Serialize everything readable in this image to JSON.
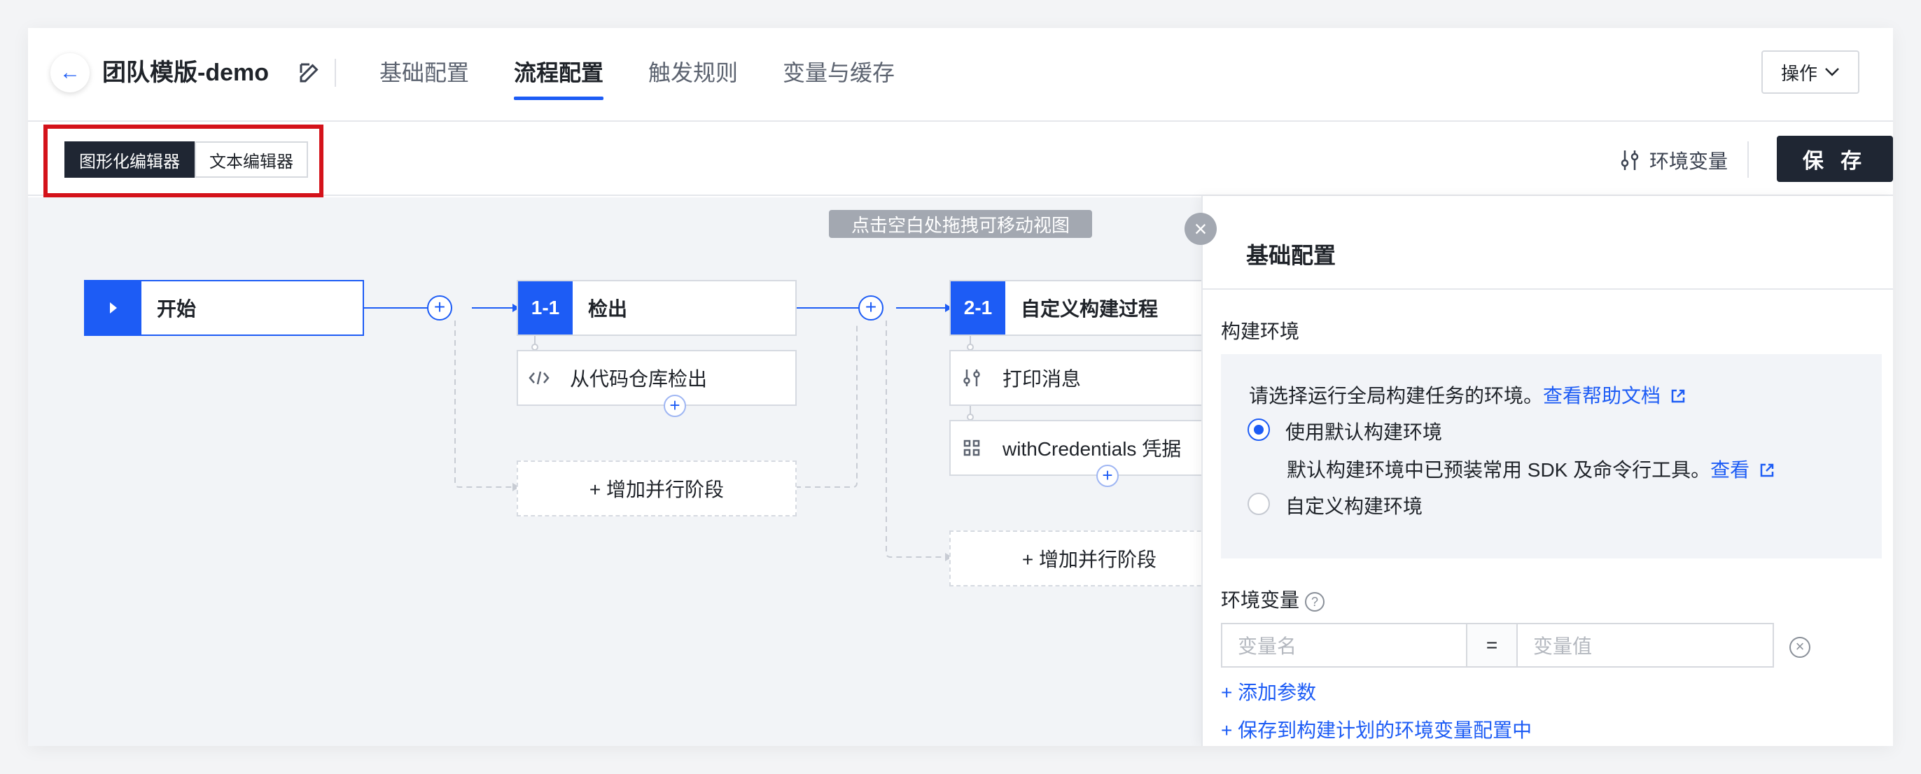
{
  "header": {
    "title": "团队模版-demo",
    "tabs": [
      {
        "label": "基础配置"
      },
      {
        "label": "流程配置"
      },
      {
        "label": "触发规则"
      },
      {
        "label": "变量与缓存"
      }
    ],
    "active_tab": "流程配置",
    "ops_label": "操作"
  },
  "toolbar": {
    "editor_modes": [
      "图形化编辑器",
      "文本编辑器"
    ],
    "active_mode": "图形化编辑器",
    "env_var_label": "环境变量",
    "save_label": "保 存"
  },
  "canvas": {
    "hint": "点击空白处拖拽可移动视图",
    "start_label": "开始",
    "stages": [
      {
        "badge": "1-1",
        "title": "检出",
        "steps": [
          "从代码仓库检出"
        ],
        "add_parallel": "+ 增加并行阶段"
      },
      {
        "badge": "2-1",
        "title": "自定义构建过程",
        "steps": [
          "打印消息",
          "withCredentials 凭据"
        ],
        "add_parallel": "+ 增加并行阶段"
      }
    ]
  },
  "panel": {
    "title": "基础配置",
    "build_env_label": "构建环境",
    "env_prompt": "请选择运行全局构建任务的环境。",
    "help_link": "查看帮助文档",
    "option_default": "使用默认构建环境",
    "option_default_desc": "默认构建环境中已预装常用 SDK 及命令行工具。",
    "view_link": "查看",
    "option_custom": "自定义构建环境",
    "selected_option": "使用默认构建环境",
    "env_vars_label": "环境变量",
    "var_name_placeholder": "变量名",
    "equals": "=",
    "var_value_placeholder": "变量值",
    "add_param": "+ 添加参数",
    "save_to_plan": "+ 保存到构建计划的环境变量配置中"
  },
  "colors": {
    "accent": "#1d5cf5",
    "dark": "#1f2633",
    "highlight_box": "#d4121a"
  }
}
